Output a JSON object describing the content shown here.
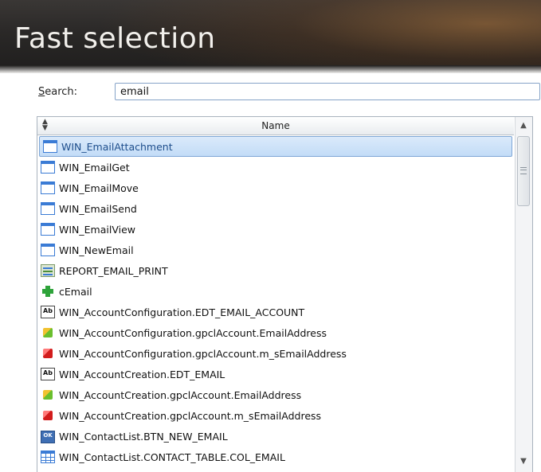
{
  "header": {
    "title": "Fast selection"
  },
  "search": {
    "label_first": "S",
    "label_rest": "earch:",
    "value": "email"
  },
  "grid": {
    "sort_glyph": "▲\n▼",
    "column_name": "Name",
    "rows": [
      {
        "icon": "window-icon",
        "label": "WIN_EmailAttachment",
        "selected": true
      },
      {
        "icon": "window-icon",
        "label": "WIN_EmailGet"
      },
      {
        "icon": "window-icon",
        "label": "WIN_EmailMove"
      },
      {
        "icon": "window-icon",
        "label": "WIN_EmailSend"
      },
      {
        "icon": "window-icon",
        "label": "WIN_EmailView"
      },
      {
        "icon": "window-icon",
        "label": "WIN_NewEmail"
      },
      {
        "icon": "report-icon",
        "label": "REPORT_EMAIL_PRINT"
      },
      {
        "icon": "green-cross-icon",
        "label": "cEmail"
      },
      {
        "icon": "edit-field-icon",
        "label": "WIN_AccountConfiguration.EDT_EMAIL_ACCOUNT",
        "icon_text": "Ab"
      },
      {
        "icon": "class-member-icon",
        "label": "WIN_AccountConfiguration.gpclAccount.EmailAddress"
      },
      {
        "icon": "class-private-member-icon",
        "label": "WIN_AccountConfiguration.gpclAccount.m_sEmailAddress"
      },
      {
        "icon": "edit-field-icon",
        "label": "WIN_AccountCreation.EDT_EMAIL",
        "icon_text": "Ab"
      },
      {
        "icon": "class-member-icon",
        "label": "WIN_AccountCreation.gpclAccount.EmailAddress"
      },
      {
        "icon": "class-private-member-icon",
        "label": "WIN_AccountCreation.gpclAccount.m_sEmailAddress"
      },
      {
        "icon": "button-icon",
        "label": "WIN_ContactList.BTN_NEW_EMAIL",
        "icon_text": "OK"
      },
      {
        "icon": "table-column-icon",
        "label": "WIN_ContactList.CONTACT_TABLE.COL_EMAIL"
      }
    ]
  },
  "scrollbar": {
    "up_glyph": "▲",
    "down_glyph": "▼"
  }
}
